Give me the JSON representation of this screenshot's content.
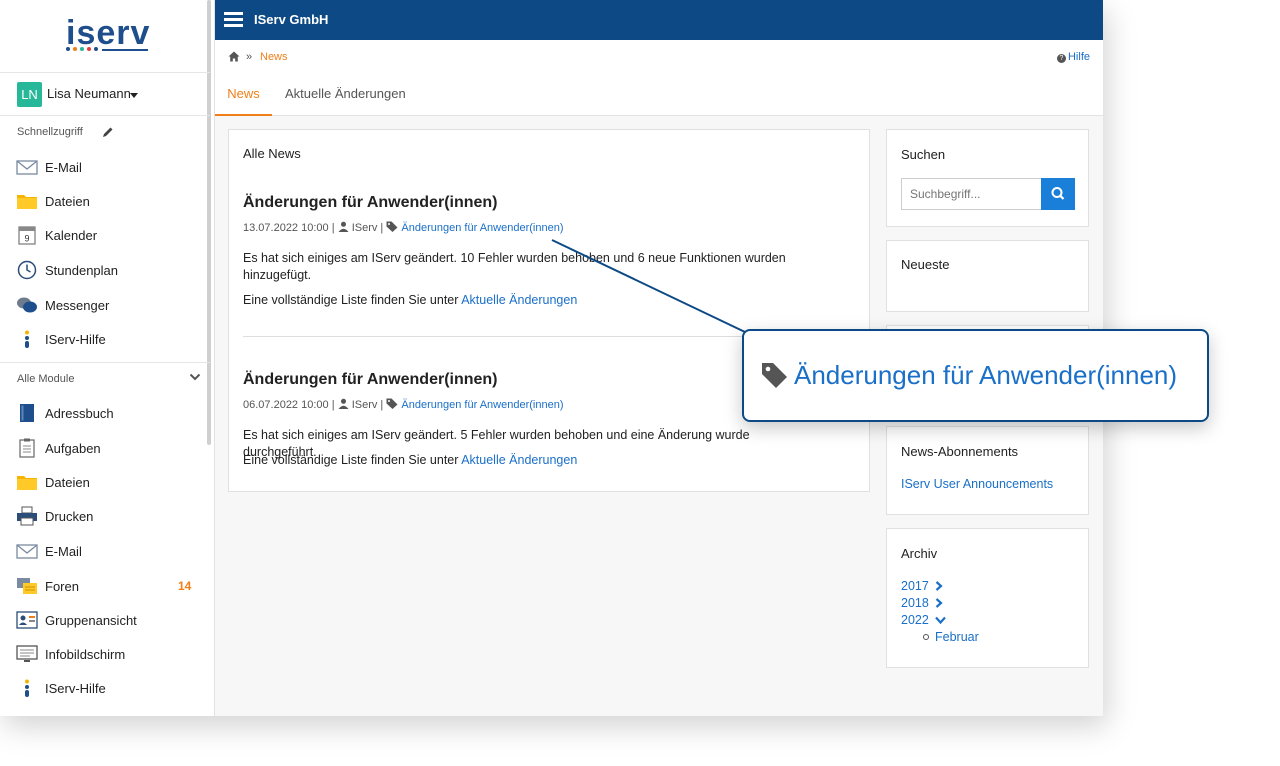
{
  "app": {
    "org_name": "IServ GmbH",
    "logo_text": "iserv",
    "logo_dot_colors": [
      "#1f4e8c",
      "#f07f18",
      "#27b89a",
      "#e23f3f",
      "#1f4e8c"
    ]
  },
  "user": {
    "initials": "LN",
    "name": "Lisa Neumann"
  },
  "sidebar": {
    "quick_access_heading": "Schnellzugriff",
    "quick_access": [
      {
        "label": "E-Mail",
        "icon": "mail-icon"
      },
      {
        "label": "Dateien",
        "icon": "folder-icon"
      },
      {
        "label": "Kalender",
        "icon": "calendar-icon",
        "icon_text": "9"
      },
      {
        "label": "Stundenplan",
        "icon": "clock-icon"
      },
      {
        "label": "Messenger",
        "icon": "chat-icon"
      },
      {
        "label": "IServ-Hilfe",
        "icon": "help-icon"
      }
    ],
    "all_modules_heading": "Alle Module",
    "modules": [
      {
        "label": "Adressbuch",
        "icon": "addressbook-icon"
      },
      {
        "label": "Aufgaben",
        "icon": "clipboard-icon"
      },
      {
        "label": "Dateien",
        "icon": "folder-icon"
      },
      {
        "label": "Drucken",
        "icon": "printer-icon"
      },
      {
        "label": "E-Mail",
        "icon": "mail-icon"
      },
      {
        "label": "Foren",
        "icon": "forum-icon",
        "badge": "14"
      },
      {
        "label": "Gruppenansicht",
        "icon": "group-icon"
      },
      {
        "label": "Infobildschirm",
        "icon": "screen-icon"
      },
      {
        "label": "IServ-Hilfe",
        "icon": "help-icon"
      }
    ]
  },
  "breadcrumb": {
    "separator": "»",
    "current": "News"
  },
  "help_link": "Hilfe",
  "tabs": [
    {
      "label": "News",
      "active": true
    },
    {
      "label": "Aktuelle Änderungen",
      "active": false
    }
  ],
  "news": {
    "heading": "Alle News",
    "items": [
      {
        "title": "Änderungen für Anwender(innen)",
        "date": "13.07.2022 10:00",
        "author": "IServ",
        "tag": "Änderungen für Anwender(innen)",
        "body": "Es hat sich einiges am IServ geändert. 10 Fehler wurden behoben und 6 neue Funktionen wurden hinzugefügt.",
        "more_prefix": "Eine vollständige Liste finden Sie unter",
        "more_link": "Aktuelle Änderungen"
      },
      {
        "title": "Änderungen für Anwender(innen)",
        "date": "06.07.2022 10:00",
        "author": "IServ",
        "tag": "Änderungen für Anwender(innen)",
        "body": "Es hat sich einiges am IServ geändert. 5 Fehler wurden behoben und eine Änderung wurde durchgeführt.",
        "more_prefix": "Eine vollständige Liste finden Sie unter",
        "more_link": "Aktuelle Änderungen"
      }
    ]
  },
  "side": {
    "search_title": "Suchen",
    "search_placeholder": "Suchbegriff...",
    "newest_title": "Neueste",
    "subscriptions_title": "News-Abonnements",
    "subscription_link": "IServ User Announcements",
    "archive_title": "Archiv",
    "archive_years": [
      {
        "year": "2017",
        "expanded": false
      },
      {
        "year": "2018",
        "expanded": false
      },
      {
        "year": "2022",
        "expanded": true
      }
    ],
    "archive_months": [
      "Februar"
    ]
  },
  "callout": {
    "text": "Änderungen für Anwender(innen)"
  },
  "colors": {
    "topbar": "#0d4a85",
    "accent_orange": "#f07f18",
    "link_blue": "#1a6fc8",
    "avatar_green": "#27b89a",
    "search_button": "#1a7fd8"
  }
}
